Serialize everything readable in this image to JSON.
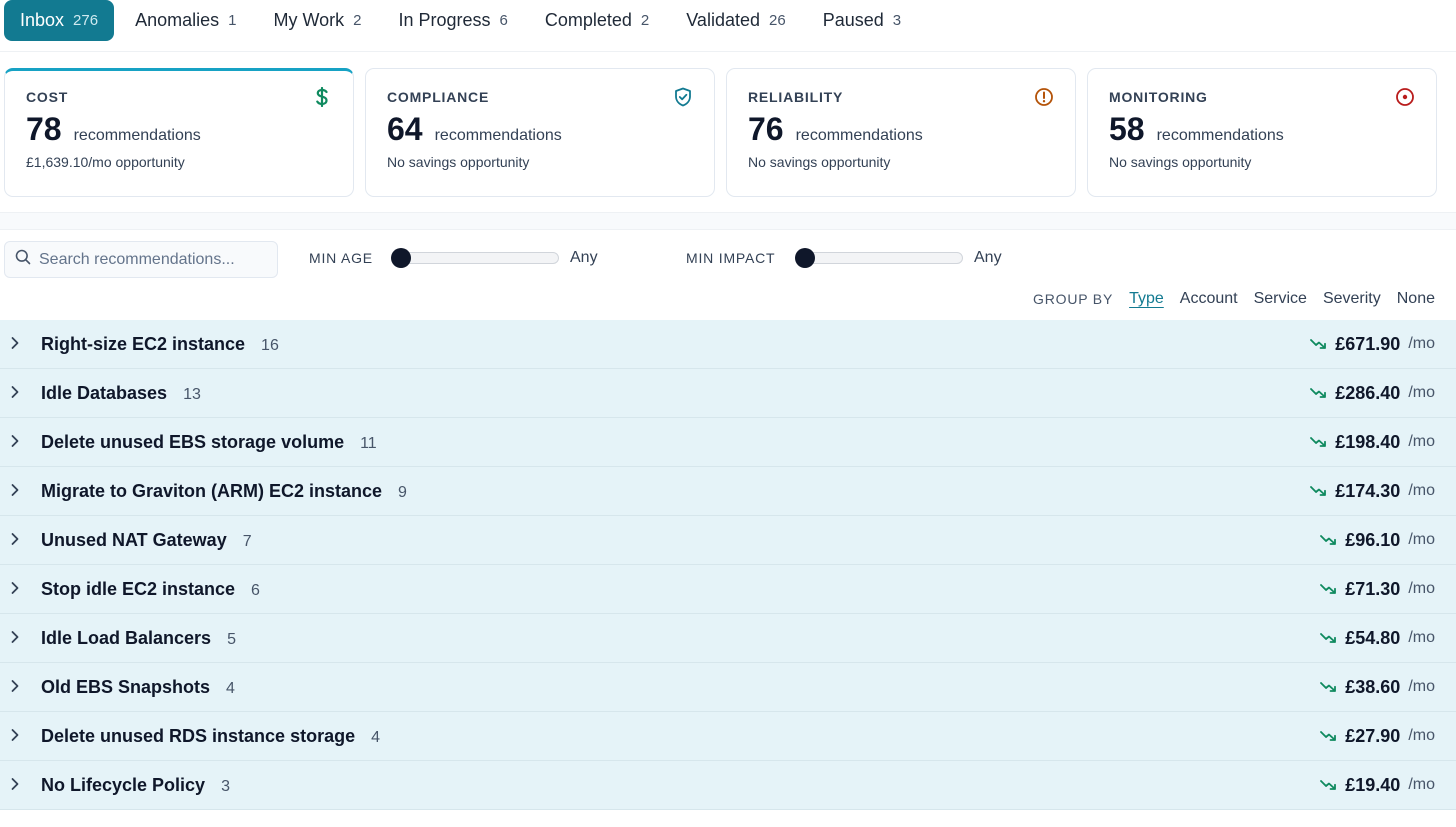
{
  "tabs": [
    {
      "label": "Inbox",
      "count": "276"
    },
    {
      "label": "Anomalies",
      "count": "1"
    },
    {
      "label": "My Work",
      "count": "2"
    },
    {
      "label": "In Progress",
      "count": "6"
    },
    {
      "label": "Completed",
      "count": "2"
    },
    {
      "label": "Validated",
      "count": "26"
    },
    {
      "label": "Paused",
      "count": "3"
    }
  ],
  "cards": [
    {
      "title": "COST",
      "number": "78",
      "unit": "recommendations",
      "sub": "£1,639.10/mo opportunity",
      "icon": "dollar-icon",
      "color": "#0f8a5f"
    },
    {
      "title": "COMPLIANCE",
      "number": "64",
      "unit": "recommendations",
      "sub": "No savings opportunity",
      "icon": "shield-check-icon",
      "color": "#127a91"
    },
    {
      "title": "RELIABILITY",
      "number": "76",
      "unit": "recommendations",
      "sub": "No savings opportunity",
      "icon": "alert-circle-icon",
      "color": "#b45309"
    },
    {
      "title": "MONITORING",
      "number": "58",
      "unit": "recommendations",
      "sub": "No savings opportunity",
      "icon": "target-icon",
      "color": "#b91c1c"
    }
  ],
  "filters": {
    "search_placeholder": "Search recommendations...",
    "min_age_label": "MIN AGE",
    "min_age_value": "Any",
    "min_impact_label": "MIN IMPACT",
    "min_impact_value": "Any"
  },
  "group_by": {
    "label": "GROUP BY",
    "options": [
      "Type",
      "Account",
      "Service",
      "Severity",
      "None"
    ],
    "selected": "Type"
  },
  "rows": [
    {
      "name": "Right-size EC2 instance",
      "count": "16",
      "amount": "£671.90",
      "per": "/mo"
    },
    {
      "name": "Idle Databases",
      "count": "13",
      "amount": "£286.40",
      "per": "/mo"
    },
    {
      "name": "Delete unused EBS storage volume",
      "count": "11",
      "amount": "£198.40",
      "per": "/mo"
    },
    {
      "name": "Migrate to Graviton (ARM) EC2 instance",
      "count": "9",
      "amount": "£174.30",
      "per": "/mo"
    },
    {
      "name": "Unused NAT Gateway",
      "count": "7",
      "amount": "£96.10",
      "per": "/mo"
    },
    {
      "name": "Stop idle EC2 instance",
      "count": "6",
      "amount": "£71.30",
      "per": "/mo"
    },
    {
      "name": "Idle Load Balancers",
      "count": "5",
      "amount": "£54.80",
      "per": "/mo"
    },
    {
      "name": "Old EBS Snapshots",
      "count": "4",
      "amount": "£38.60",
      "per": "/mo"
    },
    {
      "name": "Delete unused RDS instance storage",
      "count": "4",
      "amount": "£27.90",
      "per": "/mo"
    },
    {
      "name": "No Lifecycle Policy",
      "count": "3",
      "amount": "£19.40",
      "per": "/mo"
    }
  ],
  "colors": {
    "accent": "#127a91",
    "trend": "#0f8a5f",
    "row_bg": "#e5f3f8"
  }
}
